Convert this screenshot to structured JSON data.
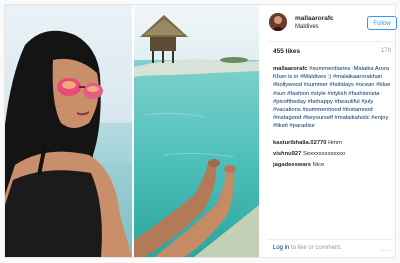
{
  "post": {
    "username": "mallaarorafc",
    "location": "Maldives",
    "follow_label": "Follow",
    "likes": "455 likes",
    "time": "17h",
    "caption_user": "mallaarorafc",
    "caption_pre": "#summerdiaries :Malaika Arora Khan is in ",
    "caption_tag_maldives": "#Maldives",
    "caption_post": " :)",
    "caption_tags": "#malaikaarorakhan #bollywood #summer #holidays #ocean #blue #sun #fashion #style #stylish #fashionista #picoftheday #behappy #beautiful #july #vacations #summermood #instamood #instagood #beyourself #malaikaholic #enjoy #likeit #paradise",
    "comments": [
      {
        "user": "kasturibhalla.02770",
        "text": "Hmm"
      },
      {
        "user": "vishnu927",
        "text": "Sexxxxxxxxxxxo"
      },
      {
        "user": "jagadeeswars",
        "text": "Nice"
      }
    ],
    "login_link": "Log in",
    "login_rest": " to like or comment.",
    "more_label": "..."
  },
  "colors": {
    "link_blue": "#003569",
    "follow_blue": "#3897f0",
    "text": "#262626",
    "muted": "#999999"
  },
  "icons": [
    "user-avatar",
    "more-options-icon"
  ]
}
